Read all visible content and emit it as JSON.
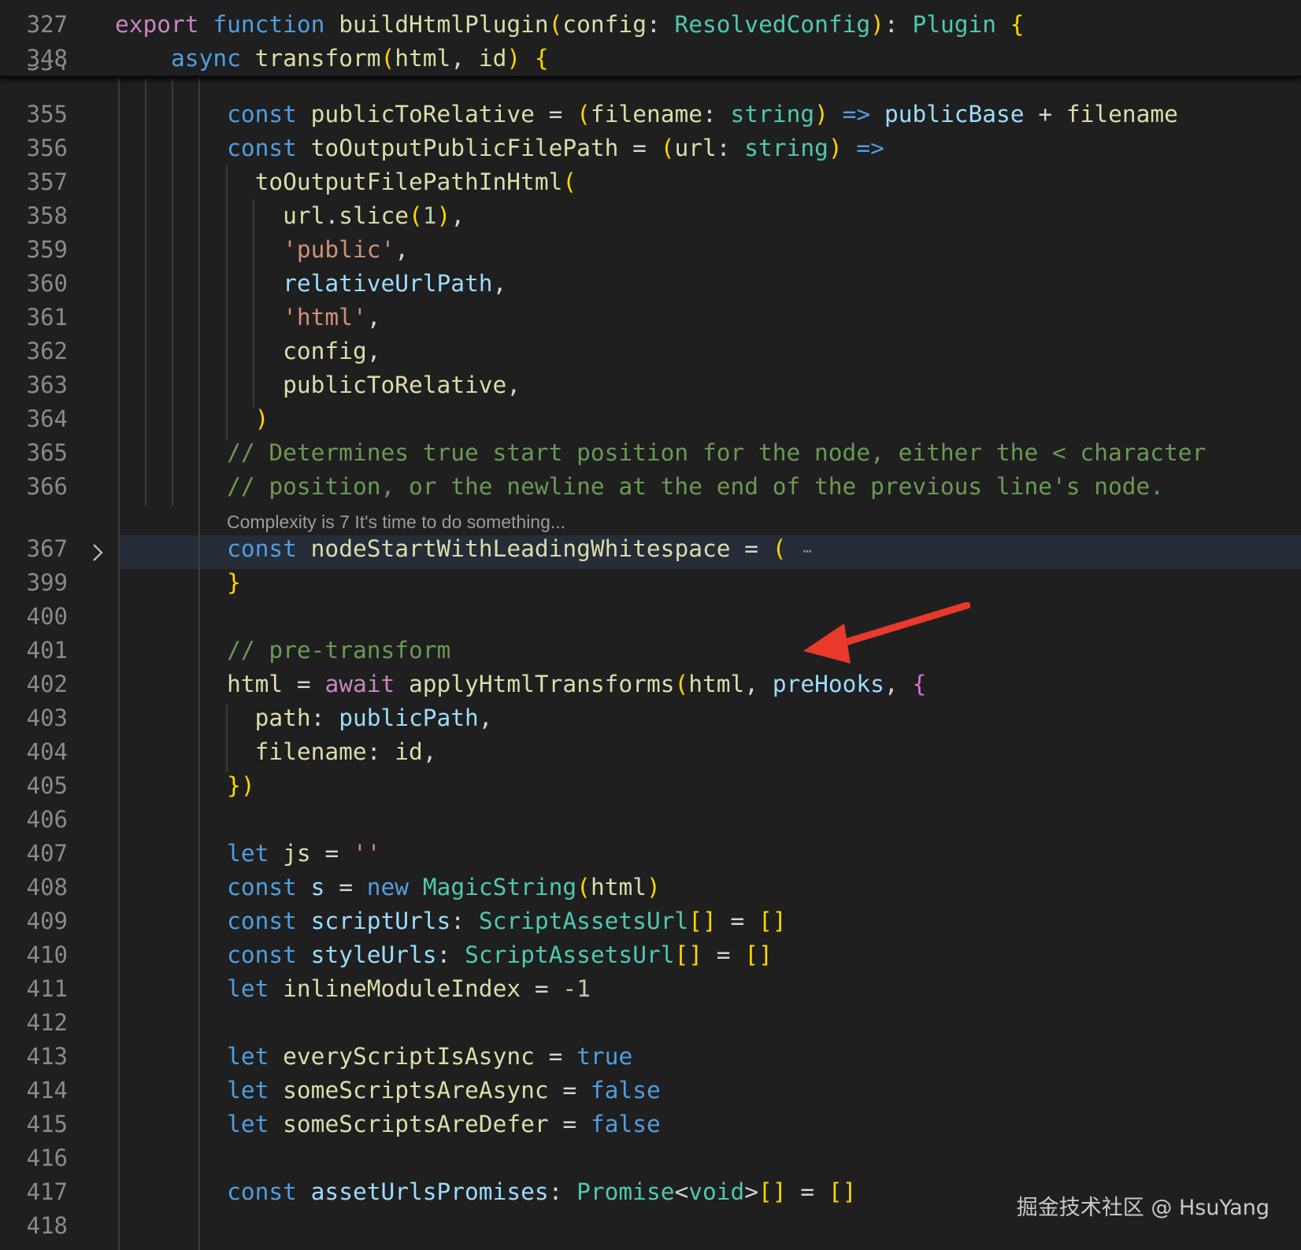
{
  "editor": {
    "sticky": [
      {
        "num": "327",
        "text": "export function buildHtmlPlugin(config: ResolvedConfig): Plugin {"
      },
      {
        "num": "348",
        "text": "    async transform(html, id) {"
      }
    ],
    "partial_line_num": "354",
    "lines": [
      {
        "num": "355",
        "text": "        const publicToRelative = (filename: string) => publicBase + filename"
      },
      {
        "num": "356",
        "text": "        const toOutputPublicFilePath = (url: string) =>"
      },
      {
        "num": "357",
        "text": "          toOutputFilePathInHtml("
      },
      {
        "num": "358",
        "text": "            url.slice(1),"
      },
      {
        "num": "359",
        "text": "            'public',"
      },
      {
        "num": "360",
        "text": "            relativeUrlPath,"
      },
      {
        "num": "361",
        "text": "            'html',"
      },
      {
        "num": "362",
        "text": "            config,"
      },
      {
        "num": "363",
        "text": "            publicToRelative,"
      },
      {
        "num": "364",
        "text": "          )"
      },
      {
        "num": "365",
        "text": "        // Determines true start position for the node, either the < character"
      },
      {
        "num": "366",
        "text": "        // position, or the newline at the end of the previous line's node."
      },
      {
        "num": "367",
        "text": "        const nodeStartWithLeadingWhitespace = ("
      },
      {
        "num": "399",
        "text": "        }"
      },
      {
        "num": "400",
        "text": ""
      },
      {
        "num": "401",
        "text": "        // pre-transform"
      },
      {
        "num": "402",
        "text": "        html = await applyHtmlTransforms(html, preHooks, {"
      },
      {
        "num": "403",
        "text": "          path: publicPath,"
      },
      {
        "num": "404",
        "text": "          filename: id,"
      },
      {
        "num": "405",
        "text": "        })"
      },
      {
        "num": "406",
        "text": ""
      },
      {
        "num": "407",
        "text": "        let js = ''"
      },
      {
        "num": "408",
        "text": "        const s = new MagicString(html)"
      },
      {
        "num": "409",
        "text": "        const scriptUrls: ScriptAssetsUrl[] = []"
      },
      {
        "num": "410",
        "text": "        const styleUrls: ScriptAssetsUrl[] = []"
      },
      {
        "num": "411",
        "text": "        let inlineModuleIndex = -1"
      },
      {
        "num": "412",
        "text": ""
      },
      {
        "num": "413",
        "text": "        let everyScriptIsAsync = true"
      },
      {
        "num": "414",
        "text": "        let someScriptsAreAsync = false"
      },
      {
        "num": "415",
        "text": "        let someScriptsAreDefer = false"
      },
      {
        "num": "416",
        "text": ""
      },
      {
        "num": "417",
        "text": "        const assetUrlsPromises: Promise<void>[] = []"
      },
      {
        "num": "418",
        "text": ""
      }
    ],
    "codelens": "Complexity is 7 It's time to do something...",
    "fold_icon": "chevron-right-icon",
    "folded_ellipsis": "⋯",
    "highlight_color": "#262d38",
    "background_color": "#1f1f1f"
  },
  "watermark": "掘金技术社区 @ HsuYang",
  "annotation": {
    "arrow_color": "#e8392b"
  }
}
